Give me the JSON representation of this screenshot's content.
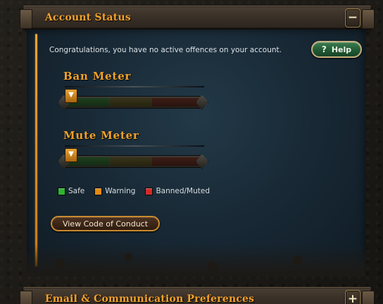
{
  "account_status": {
    "title": "Account Status",
    "toggle_symbol": "−",
    "message": "Congratulations, you have no active offences on your account.",
    "help": {
      "icon": "?",
      "label": "Help"
    }
  },
  "ban_meter": {
    "title": "Ban Meter",
    "level": 0.0,
    "pointer_icon": "triangle-down-icon"
  },
  "mute_meter": {
    "title": "Mute Meter",
    "level": 0.0,
    "pointer_icon": "triangle-down-icon"
  },
  "legend": [
    {
      "label": "Safe",
      "color": "#2fb52f"
    },
    {
      "label": "Warning",
      "color": "#e68a10"
    },
    {
      "label": "Banned/Muted",
      "color": "#d42a2a"
    }
  ],
  "conduct_button": {
    "label": "View Code of Conduct"
  },
  "email_section": {
    "title": "Email & Communication Preferences",
    "toggle_symbol": "+"
  },
  "colors": {
    "accent_gold": "#f3a12a",
    "panel_blue": "#172733",
    "help_green": "#215a34"
  }
}
